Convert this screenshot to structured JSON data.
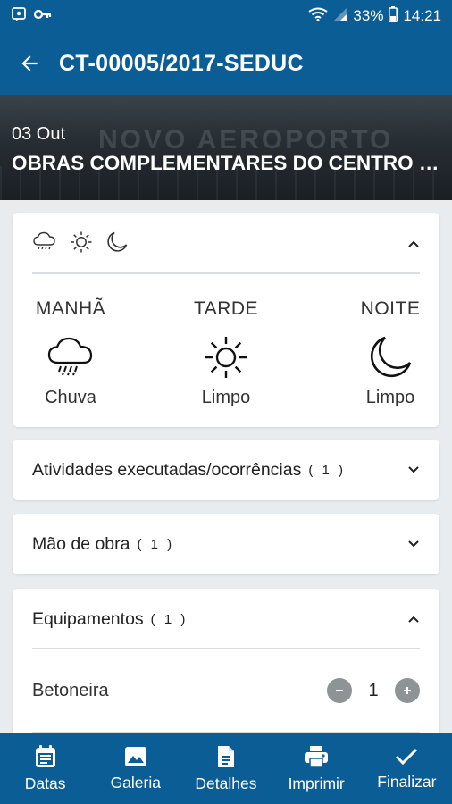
{
  "status": {
    "battery": "33%",
    "time": "14:21"
  },
  "appbar": {
    "title": "CT-00005/2017-SEDUC"
  },
  "banner": {
    "bg_text": "NOVO AEROPORTO",
    "date": "03 Out",
    "title": "OBRAS COMPLEMENTARES DO CENTRO DE CONVENÇÕES"
  },
  "weather": {
    "header_icons": [
      "rain-cloud-icon",
      "sun-icon",
      "moon-icon"
    ],
    "periods": [
      {
        "label": "MANHÃ",
        "condition": "Chuva",
        "icon": "rain-cloud-icon"
      },
      {
        "label": "TARDE",
        "condition": "Limpo",
        "icon": "sun-icon"
      },
      {
        "label": "NOITE",
        "condition": "Limpo",
        "icon": "moon-icon"
      }
    ]
  },
  "sections": {
    "atividades": {
      "label": "Atividades executadas/ocorrências",
      "count": "( 1 )"
    },
    "mao_obra": {
      "label": "Mão de obra",
      "count": "( 1 )"
    },
    "equipamentos": {
      "label": "Equipamentos",
      "count": "( 1 )"
    }
  },
  "equipment": [
    {
      "name": "Betoneira",
      "quantity": "1"
    }
  ],
  "bottom_nav": [
    {
      "label": "Datas",
      "icon": "calendar-icon"
    },
    {
      "label": "Galeria",
      "icon": "image-icon"
    },
    {
      "label": "Detalhes",
      "icon": "document-icon"
    },
    {
      "label": "Imprimir",
      "icon": "printer-icon"
    },
    {
      "label": "Finalizar",
      "icon": "check-icon"
    }
  ],
  "colors": {
    "primary": "#0b5d96",
    "background": "#e9ecef",
    "card": "#ffffff",
    "stepper": "#8e9396"
  }
}
